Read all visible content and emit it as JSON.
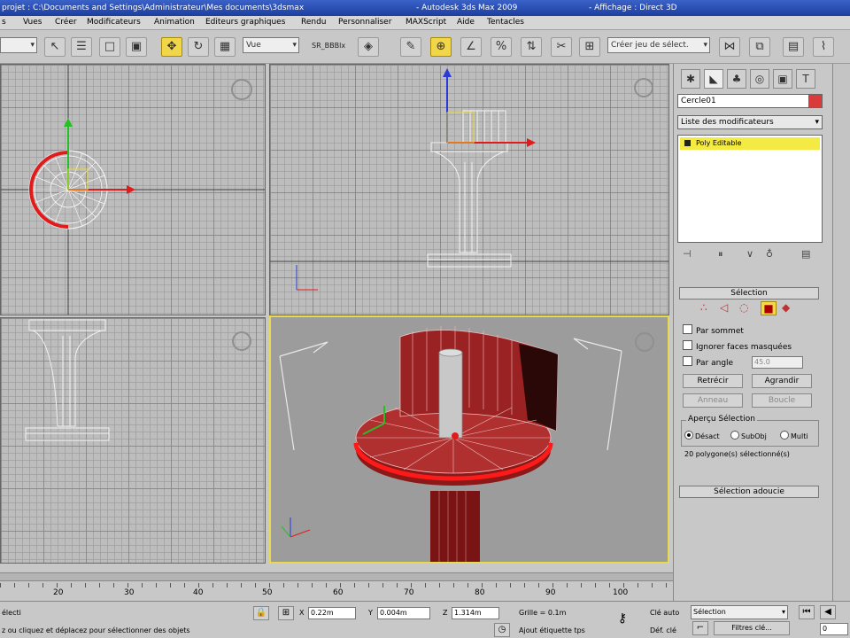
{
  "titlebar": {
    "project_path": "projet : C:\\Documents and Settings\\Administrateur\\Mes documents\\3dsmax",
    "app_title": "- Autodesk 3ds Max 2009",
    "display_mode": "- Affichage : Direct 3D"
  },
  "menu": [
    "s",
    "Vues",
    "Créer",
    "Modificateurs",
    "Animation",
    "Editeurs graphiques",
    "Rendu",
    "Personnaliser",
    "MAXScript",
    "Aide",
    "Tentacles"
  ],
  "toolbar": {
    "reference_coord": "Vue",
    "snap_label": "SR_BBBlx",
    "named_selection_placeholder": "Créer jeu de sélect."
  },
  "command_panel": {
    "object_name": "Cercle01",
    "object_color": "#d93a3a",
    "modifier_list_label": "Liste des modificateurs",
    "stack_item": "Poly Editable",
    "selection_rollout": {
      "title": "Sélection",
      "by_vertex": "Par sommet",
      "ignore_backfacing": "Ignorer faces masquées",
      "by_angle": "Par angle",
      "angle_value": "45.0",
      "shrink": "Retrécir",
      "grow": "Agrandir",
      "ring": "Anneau",
      "loop": "Boucle",
      "preview_group": "Aperçu Sélection",
      "preview_options": [
        "Désact",
        "SubObj",
        "Multi"
      ],
      "status": "20 polygone(s) sélectionné(s)"
    },
    "soft_selection_title": "Sélection adoucie"
  },
  "timeline": {
    "ticks": [
      "20",
      "30",
      "40",
      "50",
      "60",
      "70",
      "80",
      "90",
      "100"
    ]
  },
  "statusbar": {
    "selection_text": "électi",
    "prompt": "z ou cliquez et déplacez pour sélectionner des objets",
    "x_value": "0.22m",
    "y_value": "0.004m",
    "z_value": "1.314m",
    "grid": "Grille = 0.1m",
    "add_time_tag": "Ajout étiquette tps",
    "auto_key": "Clé auto",
    "set_key": "Déf. clé",
    "key_mode": "Sélection",
    "key_filters": "Filtres clé..."
  }
}
